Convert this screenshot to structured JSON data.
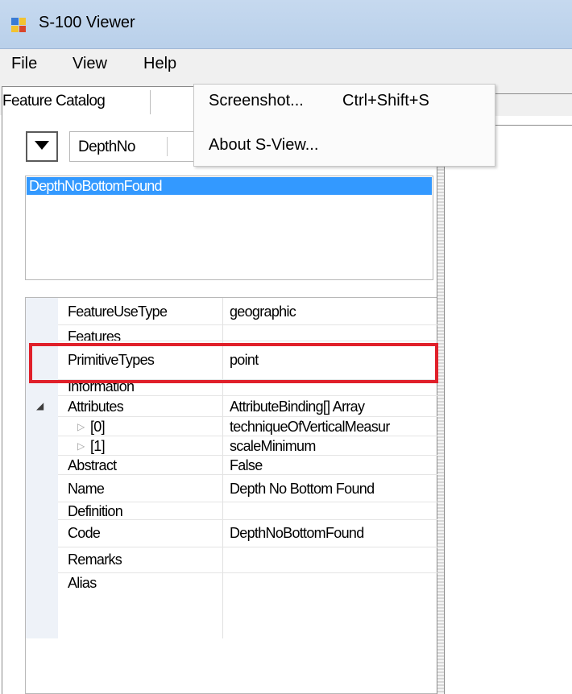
{
  "window": {
    "title": "S-100 Viewer"
  },
  "menu": {
    "file": "File",
    "view": "View",
    "help": "Help"
  },
  "tabs": {
    "active_label": "Feature Catalog"
  },
  "search": {
    "value": "DepthNo"
  },
  "view_menu": {
    "screenshot_label": "Screenshot...",
    "screenshot_shortcut": "Ctrl+Shift+S",
    "about_label": "About S-View..."
  },
  "feature_list": {
    "selected": "DepthNoBottomFound"
  },
  "properties": {
    "rows": [
      {
        "name": "FeatureUseType",
        "value": "geographic"
      },
      {
        "name": "Features",
        "value": ""
      },
      {
        "name": "PrimitiveTypes",
        "value": "point"
      },
      {
        "name": "Information",
        "value": ""
      },
      {
        "name": "Attributes",
        "value": "AttributeBinding[] Array"
      },
      {
        "name": "[0]",
        "value": "techniqueOfVerticalMeasur"
      },
      {
        "name": "[1]",
        "value": "scaleMinimum"
      },
      {
        "name": "Abstract",
        "value": "False"
      },
      {
        "name": "Name",
        "value": "Depth No Bottom Found"
      },
      {
        "name": "Definition",
        "value": ""
      },
      {
        "name": "Code",
        "value": "DepthNoBottomFound"
      },
      {
        "name": "Remarks",
        "value": ""
      },
      {
        "name": "Alias",
        "value": ""
      }
    ]
  },
  "colors": {
    "selection": "#3399ff",
    "highlight": "#e0202a",
    "titlebar": "#c6d9ef"
  }
}
